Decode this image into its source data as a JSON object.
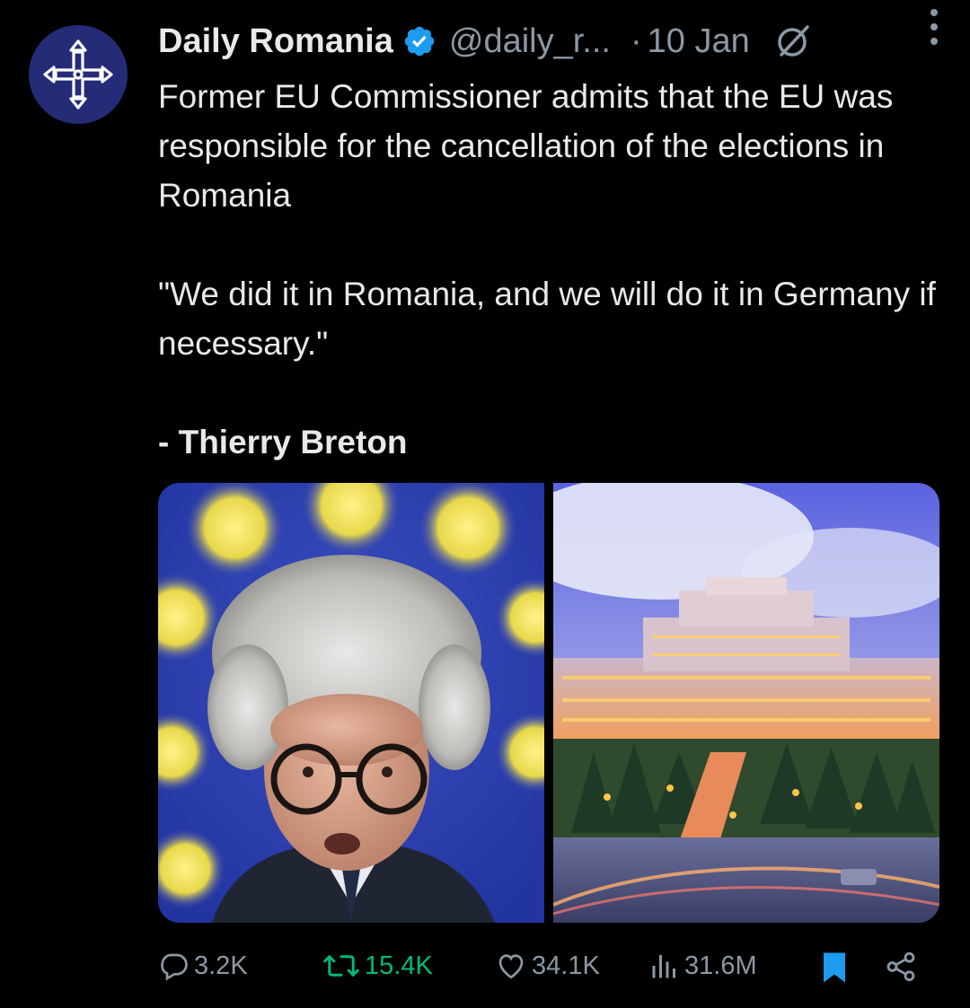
{
  "author": {
    "name": "Daily Romania",
    "handle": "@daily_r...",
    "separator": "·",
    "date": "10 Jan"
  },
  "post": {
    "line1": "Former EU Commissioner admits that the EU was responsible for the cancellation of the elections in Romania",
    "quote": "\"We did it in Romania, and we will do it in Germany if necessary.\"",
    "signature": "- Thierry Breton"
  },
  "stats": {
    "replies": "3.2K",
    "reposts": "15.4K",
    "likes": "34.1K",
    "views": "31.6M"
  },
  "colors": {
    "background": "#000000",
    "text": "#e7e9ea",
    "muted": "#8b98a5",
    "verified": "#1d9bf0",
    "repost": "#00ba7c",
    "bookmark": "#1d9bf0",
    "avatar_bg": "#252c77"
  },
  "icons": {
    "avatar": "cross-logo-icon",
    "verified": "verified-badge-icon",
    "grok": "grok-icon",
    "more": "more-icon",
    "reply": "reply-icon",
    "repost": "repost-icon",
    "like": "heart-icon",
    "views": "views-icon",
    "bookmark": "bookmark-icon",
    "share": "share-icon"
  }
}
